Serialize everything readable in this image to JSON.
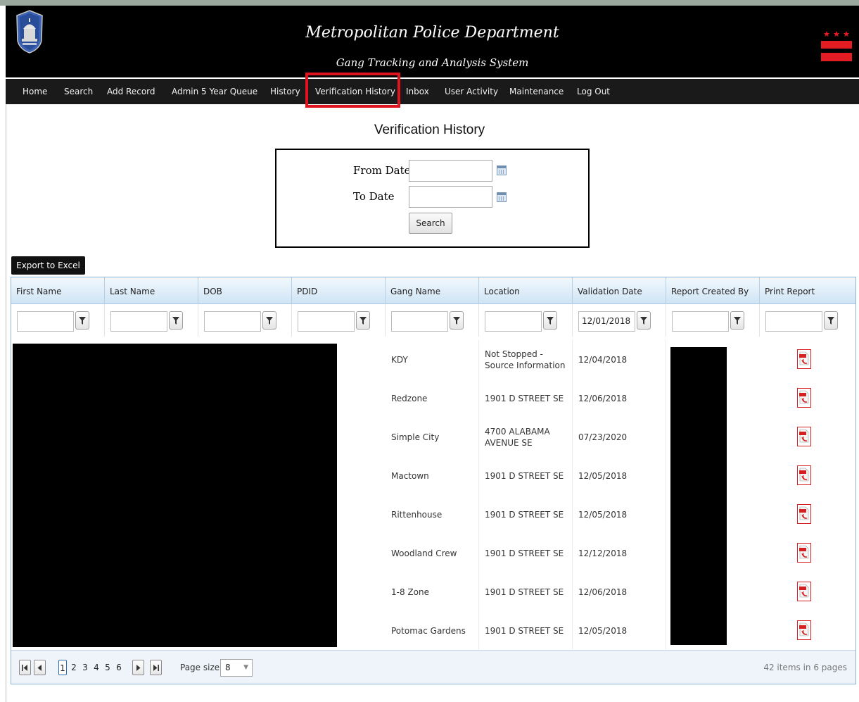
{
  "header": {
    "title": "Metropolitan Police Department",
    "subtitle": "Gang Tracking and Analysis System"
  },
  "nav": {
    "items": [
      "Home",
      "Search",
      "Add Record",
      "Admin 5 Year Queue",
      "History",
      "Verification History",
      "Inbox",
      "User Activity",
      "Maintenance",
      "Log Out"
    ],
    "active": "Verification History"
  },
  "page": {
    "title": "Verification History"
  },
  "date_filter": {
    "from_label": "From Date",
    "to_label": "To Date",
    "from_value": "",
    "to_value": "",
    "search_label": "Search"
  },
  "export_label": "Export to Excel",
  "grid": {
    "columns": [
      "First Name",
      "Last Name",
      "DOB",
      "PDID",
      "Gang Name",
      "Location",
      "Validation Date",
      "Report Created By",
      "Print Report"
    ],
    "filters": [
      "",
      "",
      "",
      "",
      "",
      "",
      "12/01/2018",
      "",
      ""
    ],
    "rows": [
      {
        "gang": "KDY",
        "location": "Not Stopped - Source Information",
        "date": "12/04/2018"
      },
      {
        "gang": "Redzone",
        "location": "1901 D STREET SE",
        "date": "12/06/2018"
      },
      {
        "gang": "Simple City",
        "location": "4700 ALABAMA AVENUE SE",
        "date": "07/23/2020"
      },
      {
        "gang": "Mactown",
        "location": "1901 D STREET SE",
        "date": "12/05/2018"
      },
      {
        "gang": "Rittenhouse",
        "location": "1901 D STREET SE",
        "date": "12/05/2018"
      },
      {
        "gang": "Woodland Crew",
        "location": "1901 D STREET SE",
        "date": "12/12/2018"
      },
      {
        "gang": "1-8 Zone",
        "location": "1901 D STREET SE",
        "date": "12/06/2018"
      },
      {
        "gang": "Potomac Gardens",
        "location": "1901 D STREET SE",
        "date": "12/05/2018"
      }
    ]
  },
  "pager": {
    "pages": [
      "1",
      "2",
      "3",
      "4",
      "5",
      "6"
    ],
    "current_page": "1",
    "page_size_label": "Page size:",
    "page_size": "8",
    "summary": "42 items in 6 pages"
  },
  "colors": {
    "header_bg": "#000000",
    "active_highlight": "#e0141e",
    "grid_header": "#cfe4f5",
    "pdf_red": "#d42020"
  },
  "icons": {
    "logo": "police-badge-icon",
    "flag": "dc-flag-icon",
    "calendar": "calendar-icon",
    "filter": "filter-icon",
    "report": "pdf-icon"
  }
}
